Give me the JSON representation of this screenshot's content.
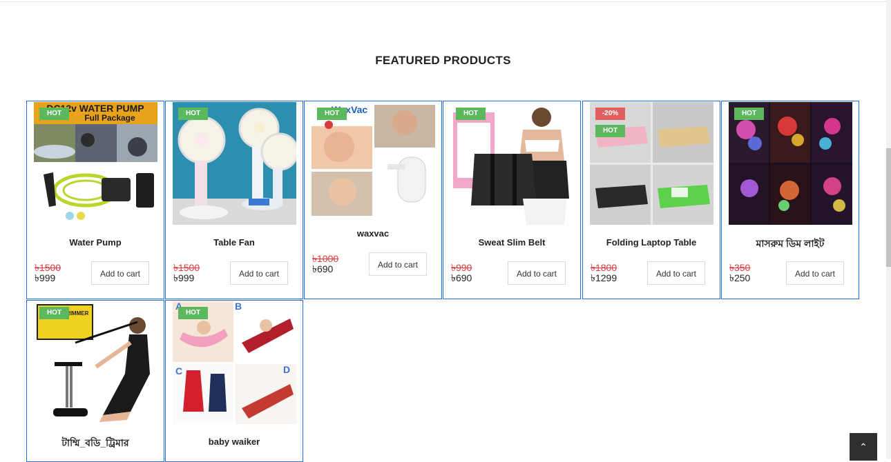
{
  "section": {
    "title": "FEATURED PRODUCTS"
  },
  "products": [
    {
      "name": "Water Pump",
      "badge": "HOT",
      "old_price": "৳1500",
      "new_price": "৳999",
      "cart": "Add to cart"
    },
    {
      "name": "Table Fan",
      "badge": "HOT",
      "old_price": "৳1500",
      "new_price": "৳999",
      "cart": "Add to cart"
    },
    {
      "name": "waxvac",
      "badge": "HOT",
      "old_price": "৳1000",
      "new_price": "৳690",
      "cart": "Add to cart"
    },
    {
      "name": "Sweat Slim Belt",
      "badge": "HOT",
      "old_price": "৳990",
      "new_price": "৳690",
      "cart": "Add to cart"
    },
    {
      "name": "Folding Laptop Table",
      "discount": "-20%",
      "badge": "HOT",
      "old_price": "৳1800",
      "new_price": "৳1299",
      "cart": "Add to cart"
    },
    {
      "name": "মাসরুম ডিম লাইট",
      "badge": "HOT",
      "old_price": "৳350",
      "new_price": "৳250",
      "cart": "Add to cart"
    },
    {
      "name": "টাম্মি_বডি_ট্রিমার",
      "badge": "HOT"
    },
    {
      "name": "baby waiker",
      "badge": "HOT"
    }
  ],
  "image_text": {
    "water_pump": "DC12v WATER PUMP",
    "water_pump_sub": "Full Package",
    "waxvac": "WaxVac",
    "trimmer": "TUMMY TRIMMER",
    "baby_labels": [
      "A",
      "B",
      "C",
      "D"
    ]
  },
  "icons": {
    "back_to_top": "chevron-up-icon"
  }
}
